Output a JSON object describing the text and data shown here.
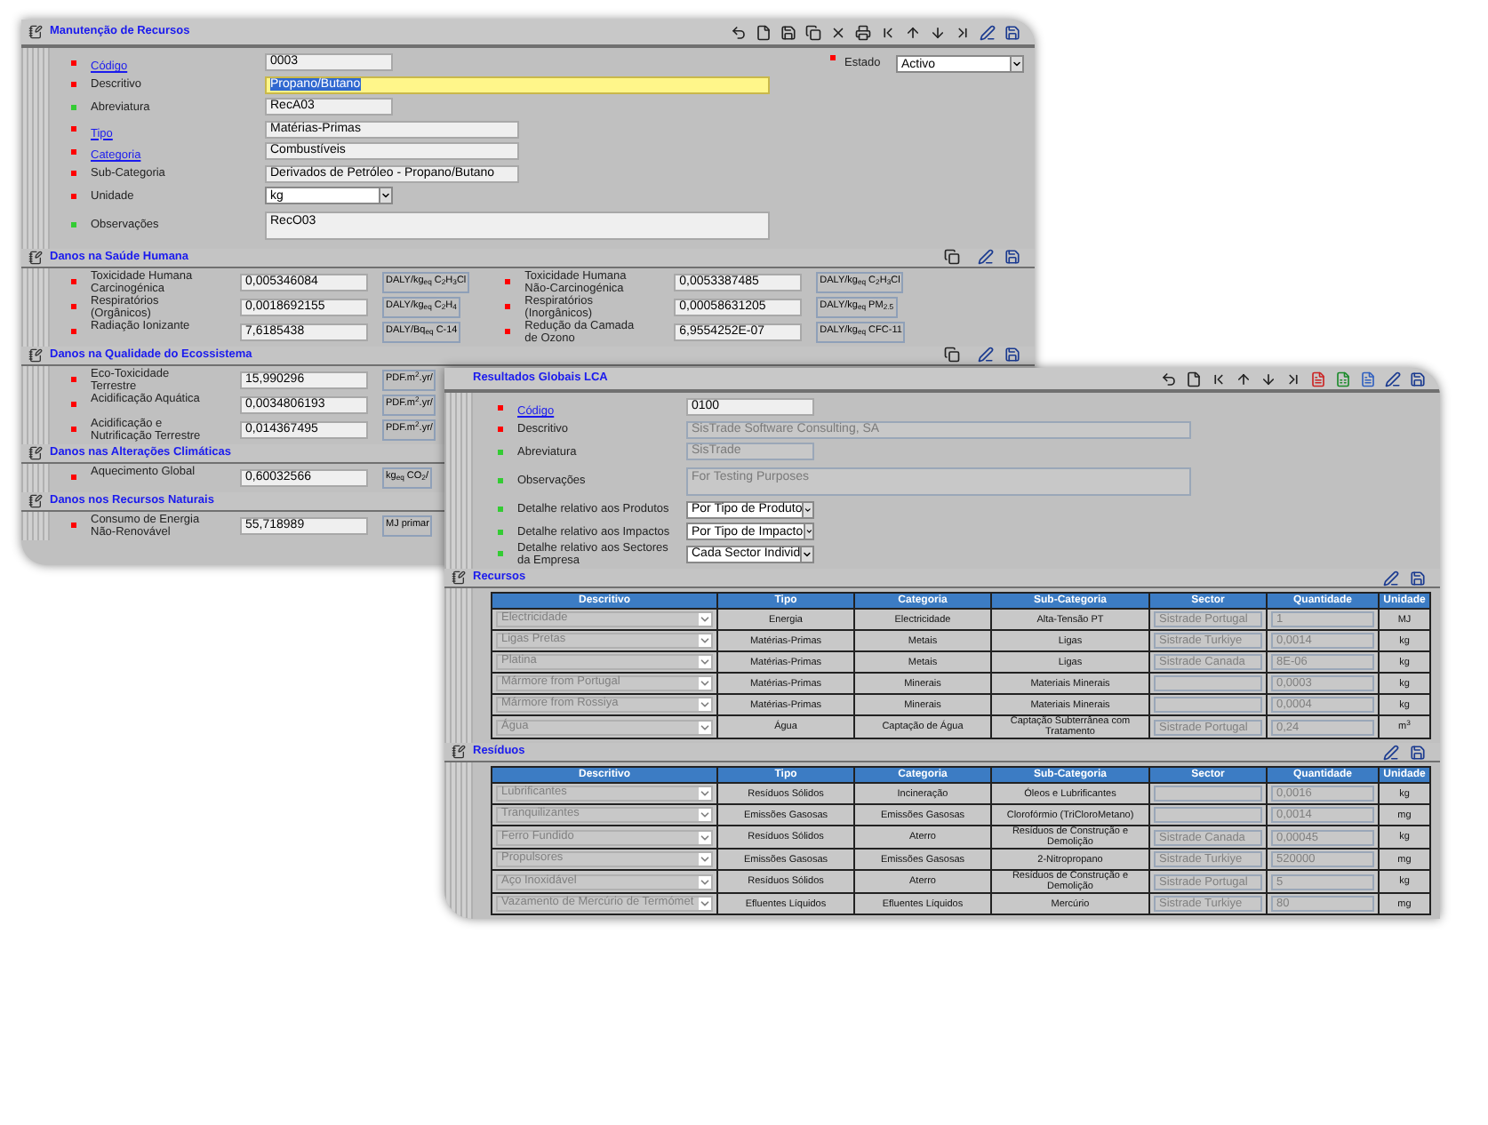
{
  "resource_window": {
    "title": "Manutenção de Recursos",
    "fields": [
      {
        "label": "Código",
        "link": true,
        "color": "#ff0000",
        "kind": "text",
        "value": "0003"
      },
      {
        "label": "Descritivo",
        "color": "#ff0000",
        "kind": "text",
        "value": "Propano/Butano",
        "highlighted": true
      },
      {
        "label": "Abreviatura",
        "color": "#33cc33",
        "kind": "text",
        "value": "RecA03"
      },
      {
        "label": "Tipo",
        "link": true,
        "color": "#ff0000",
        "kind": "text",
        "value": "Matérias-Primas"
      },
      {
        "label": "Categoria",
        "link": true,
        "color": "#ff0000",
        "kind": "text",
        "value": "Combustíveis"
      },
      {
        "label": "Sub-Categoria",
        "color": "#ff0000",
        "kind": "text",
        "value": "Derivados de Petróleo - Propano/Butano"
      },
      {
        "label": "Unidade",
        "color": "#ff0000",
        "kind": "select",
        "value": "kg"
      },
      {
        "label": "Observações",
        "color": "#33cc33",
        "kind": "textarea",
        "value": "RecO03"
      }
    ],
    "estado": {
      "label": "Estado",
      "color": "#ff0000",
      "value": "Activo"
    },
    "sections": [
      {
        "title": "Danos na Saúde Humana",
        "items": [
          {
            "label": "Toxicidade Humana Carcinogénica",
            "value": "0,005346084",
            "unit": "DALY/kg$_{eq}$ C$_{2}$H$_{3}$Cl"
          },
          {
            "label": "Toxicidade Humana Não-Carcinogénica",
            "value": "0,0053387485",
            "unit": "DALY/kg$_{eq}$ C$_{2}$H$_{3}$Cl"
          },
          {
            "label": "Respiratórios (Orgânicos)",
            "value": "0,0018692155",
            "unit": "DALY/kg$_{eq}$ C$_{2}$H$_{4}$"
          },
          {
            "label": "Respiratórios (Inorgânicos)",
            "value": "0,00058631205",
            "unit": "DALY/kg$_{eq}$ PM$_{2.5}$"
          },
          {
            "label": "Radiação Ionizante",
            "value": "7,6185438",
            "unit": "DALY/Bq$_{eq}$ C-14"
          },
          {
            "label": "Redução da Camada de Ozono",
            "value": "6,9554252E-07",
            "unit": "DALY/kg$_{eq}$ CFC-11"
          }
        ]
      },
      {
        "title": "Danos na Qualidade do Ecossistema",
        "items": [
          {
            "label": "Eco-Toxicidade Terrestre",
            "value": "15,990296",
            "unit": "PDF.m$^{2}$.yr/"
          },
          {
            "label": "Acidificação Aquática",
            "value": "0,0034806193",
            "unit": "PDF.m$^{2}$.yr/"
          },
          {
            "label": "Acidificação e Nutrificação Terrestre",
            "value": "0,014367495",
            "unit": "PDF.m$^{2}$.yr/"
          }
        ]
      },
      {
        "title": "Danos nas Alterações Climáticas",
        "items": [
          {
            "label": "Aquecimento Global",
            "value": "0,60032566",
            "unit": "kg$_{eq}$ CO$_{2}$/"
          }
        ]
      },
      {
        "title": "Danos nos Recursos Naturais",
        "items": [
          {
            "label": "Consumo de Energia Não-Renovável",
            "value": "55,718989",
            "unit": "MJ primar"
          }
        ]
      }
    ]
  },
  "results_window": {
    "title": "Resultados Globais LCA",
    "fields": [
      {
        "label": "Código",
        "link": true,
        "color": "#ff0000",
        "kind": "text",
        "value": "0100"
      },
      {
        "label": "Descritivo",
        "color": "#ff0000",
        "kind": "text",
        "value": "SisTrade Software Consulting, SA",
        "disabled": true
      },
      {
        "label": "Abreviatura",
        "color": "#33cc33",
        "kind": "text",
        "value": "SisTrade",
        "disabled": true
      },
      {
        "label": "Observações",
        "color": "#33cc33",
        "kind": "textarea",
        "value": "For Testing Purposes",
        "disabled": true
      },
      {
        "label": "Detalhe relativo aos Produtos",
        "color": "#33cc33",
        "kind": "select",
        "value": "Por Tipo de Produto"
      },
      {
        "label": "Detalhe relativo aos Impactos",
        "color": "#33cc33",
        "kind": "select",
        "value": "Por Tipo de Impacto"
      },
      {
        "label": "Detalhe relativo aos Sectores da Empresa",
        "color": "#33cc33",
        "kind": "select",
        "value": "Cada Sector Individ"
      }
    ],
    "tables": [
      {
        "title": "Recursos",
        "columns": [
          "Descritivo",
          "Tipo",
          "Categoria",
          "Sub-Categoria",
          "Sector",
          "Quantidade",
          "Unidade"
        ],
        "rows": [
          {
            "descritivo": "Electricidade",
            "tipo": "Energia",
            "categoria": "Electricidade",
            "sub_categoria": "Alta-Tensão PT",
            "sector": "Sistrade Portugal",
            "quantidade": "1",
            "unidade": "MJ"
          },
          {
            "descritivo": "Ligas Pretas",
            "tipo": "Matérias-Primas",
            "categoria": "Metais",
            "sub_categoria": "Ligas",
            "sector": "Sistrade Turkiye",
            "quantidade": "0,0014",
            "unidade": "kg"
          },
          {
            "descritivo": "Platina",
            "tipo": "Matérias-Primas",
            "categoria": "Metais",
            "sub_categoria": "Ligas",
            "sector": "Sistrade Canada",
            "quantidade": "8E-06",
            "unidade": "kg"
          },
          {
            "descritivo": "Mármore from Portugal",
            "tipo": "Matérias-Primas",
            "categoria": "Minerais",
            "sub_categoria": "Materiais Minerais",
            "quantidade": "0,0003",
            "unidade": "kg"
          },
          {
            "descritivo": "Mármore from Rossiya",
            "tipo": "Matérias-Primas",
            "categoria": "Minerais",
            "sub_categoria": "Materiais Minerais",
            "quantidade": "0,0004",
            "unidade": "kg"
          },
          {
            "descritivo": "Água",
            "tipo": "Água",
            "categoria": "Captação de Água",
            "sub_categoria": "Captação Subterrânea com Tratamento",
            "sector": "Sistrade Portugal",
            "quantidade": "0,24",
            "unidade": "m$^{3}$"
          }
        ]
      },
      {
        "title": "Resíduos",
        "columns": [
          "Descritivo",
          "Tipo",
          "Categoria",
          "Sub-Categoria",
          "Sector",
          "Quantidade",
          "Unidade"
        ],
        "rows": [
          {
            "descritivo": "Lubrificantes",
            "tipo": "Resíduos Sólidos",
            "categoria": "Incineração",
            "sub_categoria": "Óleos e Lubrificantes",
            "quantidade": "0,0016",
            "unidade": "kg"
          },
          {
            "descritivo": "Tranquilizantes",
            "tipo": "Emissões Gasosas",
            "categoria": "Emissões Gasosas",
            "sub_categoria": "Clorofórmio (TriCloroMetano)",
            "quantidade": "0,0014",
            "unidade": "mg"
          },
          {
            "descritivo": "Ferro Fundido",
            "tipo": "Resíduos Sólidos",
            "categoria": "Aterro",
            "sub_categoria": "Resíduos de Construção e Demolição",
            "sector": "Sistrade Canada",
            "quantidade": "0,00045",
            "unidade": "kg"
          },
          {
            "descritivo": "Propulsores",
            "tipo": "Emissões Gasosas",
            "categoria": "Emissões Gasosas",
            "sub_categoria": "2-Nitropropano",
            "sector": "Sistrade Turkiye",
            "quantidade": "520000",
            "unidade": "mg"
          },
          {
            "descritivo": "Aço Inoxidável",
            "tipo": "Resíduos Sólidos",
            "categoria": "Aterro",
            "sub_categoria": "Resíduos de Construção e Demolição",
            "sector": "Sistrade Portugal",
            "quantidade": "5",
            "unidade": "kg"
          },
          {
            "descritivo": "Vazamento de Mercúrio de Termómet",
            "tipo": "Efluentes Líquidos",
            "categoria": "Efluentes Líquidos",
            "sub_categoria": "Mercúrio",
            "sector": "Sistrade Turkiye",
            "quantidade": "80",
            "unidade": "mg"
          }
        ]
      }
    ]
  }
}
